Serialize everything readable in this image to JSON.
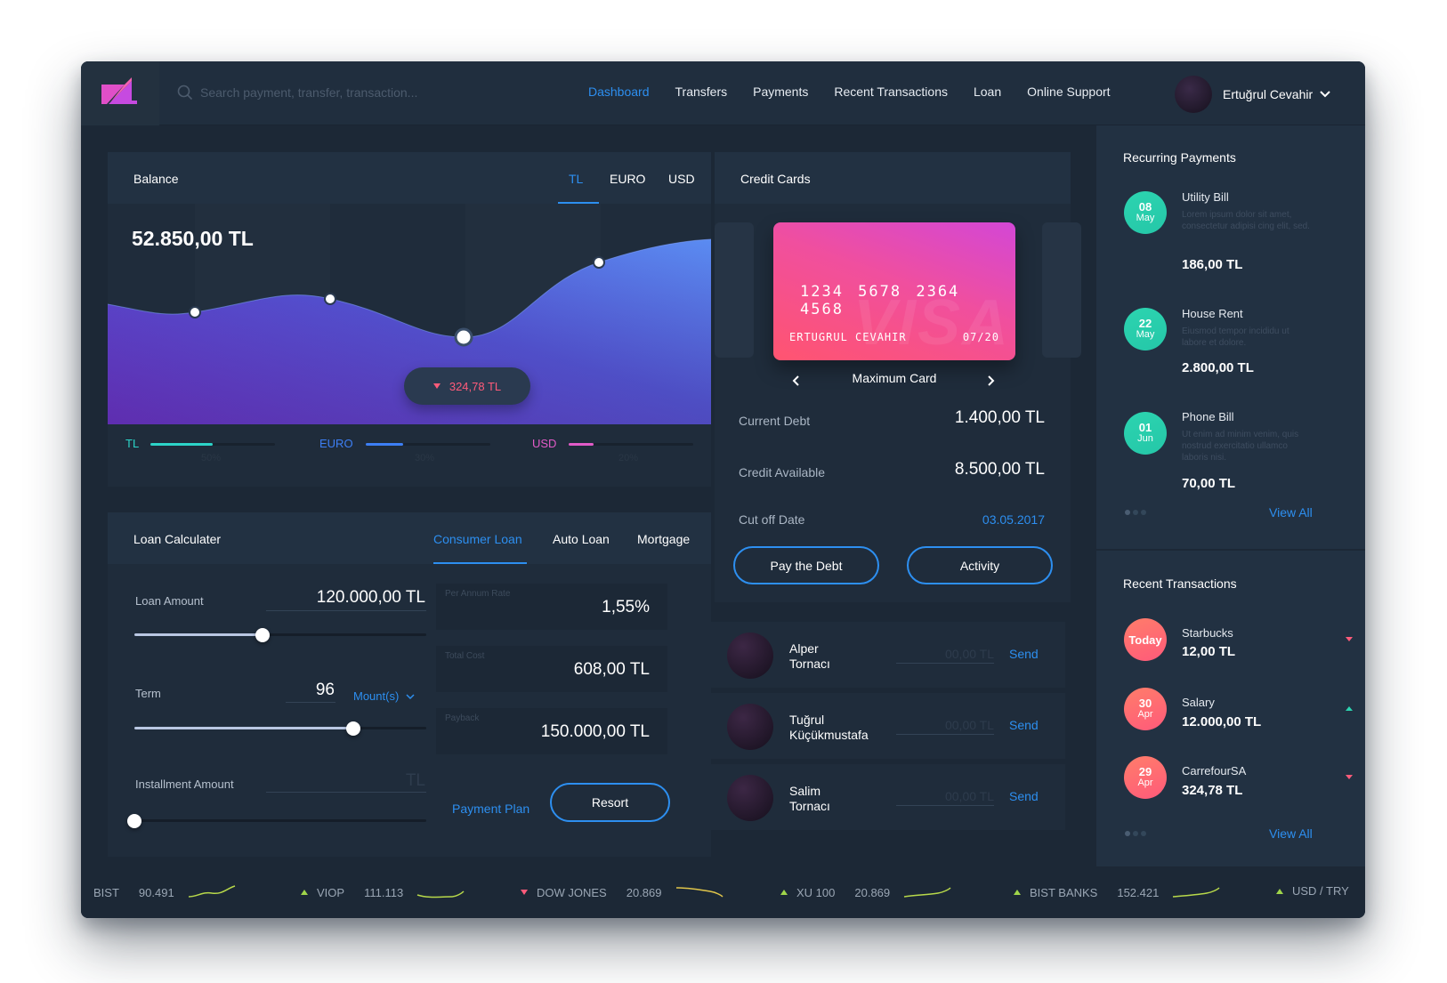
{
  "header": {
    "search_placeholder": "Search payment, transfer, transaction...",
    "nav": [
      {
        "label": "Dashboard",
        "active": true
      },
      {
        "label": "Transfers",
        "active": false
      },
      {
        "label": "Payments",
        "active": false
      },
      {
        "label": "Recent Transactions",
        "active": false
      },
      {
        "label": "Loan",
        "active": false
      },
      {
        "label": "Online Support",
        "active": false
      }
    ],
    "user_name": "Ertuğrul Cevahir"
  },
  "balance": {
    "title": "Balance",
    "tabs": [
      "TL",
      "EURO",
      "USD"
    ],
    "active_tab": "TL",
    "amount": "52.850,00 TL",
    "tooltip": "324,78 TL",
    "legend": [
      {
        "label": "TL",
        "percent_text": "50%",
        "fraction": 0.5,
        "color": "#2cd4c8"
      },
      {
        "label": "EURO",
        "percent_text": "30%",
        "fraction": 0.3,
        "color": "#3d7ff5"
      },
      {
        "label": "USD",
        "percent_text": "20%",
        "fraction": 0.2,
        "color": "#e25bc8"
      }
    ]
  },
  "loan": {
    "title": "Loan Calculater",
    "tabs": [
      "Consumer Loan",
      "Auto Loan",
      "Mortgage"
    ],
    "active_tab": "Consumer Loan",
    "amount_label": "Loan Amount",
    "amount_value": "120.000,00 TL",
    "amount_slider": 0.44,
    "term_label": "Term",
    "term_value": "96",
    "term_unit": "Mount(s)",
    "term_slider": 0.75,
    "installment_label": "Installment Amount",
    "installment_placeholder": "TL",
    "installment_slider": 0.0,
    "rate_label": "Per Annum Rate",
    "rate_value": "1,55%",
    "cost_label": "Total Cost",
    "cost_value": "608,00 TL",
    "payback_label": "Payback",
    "payback_value": "150.000,00 TL",
    "plan_link": "Payment Plan",
    "resort_button": "Resort"
  },
  "credit_cards": {
    "title": "Credit Cards",
    "card_number": "1234 5678 2364 4568",
    "card_holder": "ERTUGRUL CEVAHIR",
    "card_expiry": "07/20",
    "card_brand": "VISA",
    "card_name": "Maximum Card",
    "current_debt_label": "Current Debt",
    "current_debt_value": "1.400,00 TL",
    "credit_available_label": "Credit Available",
    "credit_available_value": "8.500,00 TL",
    "cutoff_label": "Cut off Date",
    "cutoff_value": "03.05.2017",
    "pay_button": "Pay the Debt",
    "activity_button": "Activity"
  },
  "contacts": [
    {
      "name_line1": "Alper",
      "name_line2": "Tornacı",
      "placeholder": "00,00 TL",
      "send": "Send"
    },
    {
      "name_line1": "Tuğrul",
      "name_line2": "Küçükmustafa",
      "placeholder": "00,00 TL",
      "send": "Send"
    },
    {
      "name_line1": "Salim",
      "name_line2": "Tornacı",
      "placeholder": "00,00 TL",
      "send": "Send"
    }
  ],
  "recurring": {
    "title": "Recurring Payments",
    "items": [
      {
        "day": "08",
        "month": "May",
        "title": "Utility Bill",
        "desc": "Lorem ipsum dolor sit amet, consectetur adipisi cing elit, sed.",
        "amount": "186,00 TL"
      },
      {
        "day": "22",
        "month": "May",
        "title": "House Rent",
        "desc": "Eiusmod tempor incididu ut labore et dolore.",
        "amount": "2.800,00 TL"
      },
      {
        "day": "01",
        "month": "Jun",
        "title": "Phone Bill",
        "desc": "Ut enim ad minim venim, quis nostrud exercitatio ullamco laboris nisi.",
        "amount": "70,00 TL"
      }
    ],
    "view_all": "View All"
  },
  "recent": {
    "title": "Recent Transactions",
    "items": [
      {
        "day": "Today",
        "month": "",
        "title": "Starbucks",
        "amount": "12,00 TL",
        "direction": "down"
      },
      {
        "day": "30",
        "month": "Apr",
        "title": "Salary",
        "amount": "12.000,00 TL",
        "direction": "up"
      },
      {
        "day": "29",
        "month": "Apr",
        "title": "CarrefourSA",
        "amount": "324,78 TL",
        "direction": "down"
      }
    ],
    "view_all": "View All"
  },
  "ticker": [
    {
      "name": "BIST",
      "value": "90.491",
      "direction": "up"
    },
    {
      "name": "VIOP",
      "value": "111.113",
      "direction": "up"
    },
    {
      "name": "DOW JONES",
      "value": "20.869",
      "direction": "down"
    },
    {
      "name": "XU 100",
      "value": "20.869",
      "direction": "up"
    },
    {
      "name": "BIST BANKS",
      "value": "152.421",
      "direction": "up"
    },
    {
      "name": "USD / TRY",
      "value": "",
      "direction": "up"
    }
  ],
  "colors": {
    "accent": "#2d8ff0",
    "background": "#1c2836",
    "panel": "#1f2c3b",
    "positive": "#2cd4b0",
    "negative": "#ff5b7a"
  }
}
